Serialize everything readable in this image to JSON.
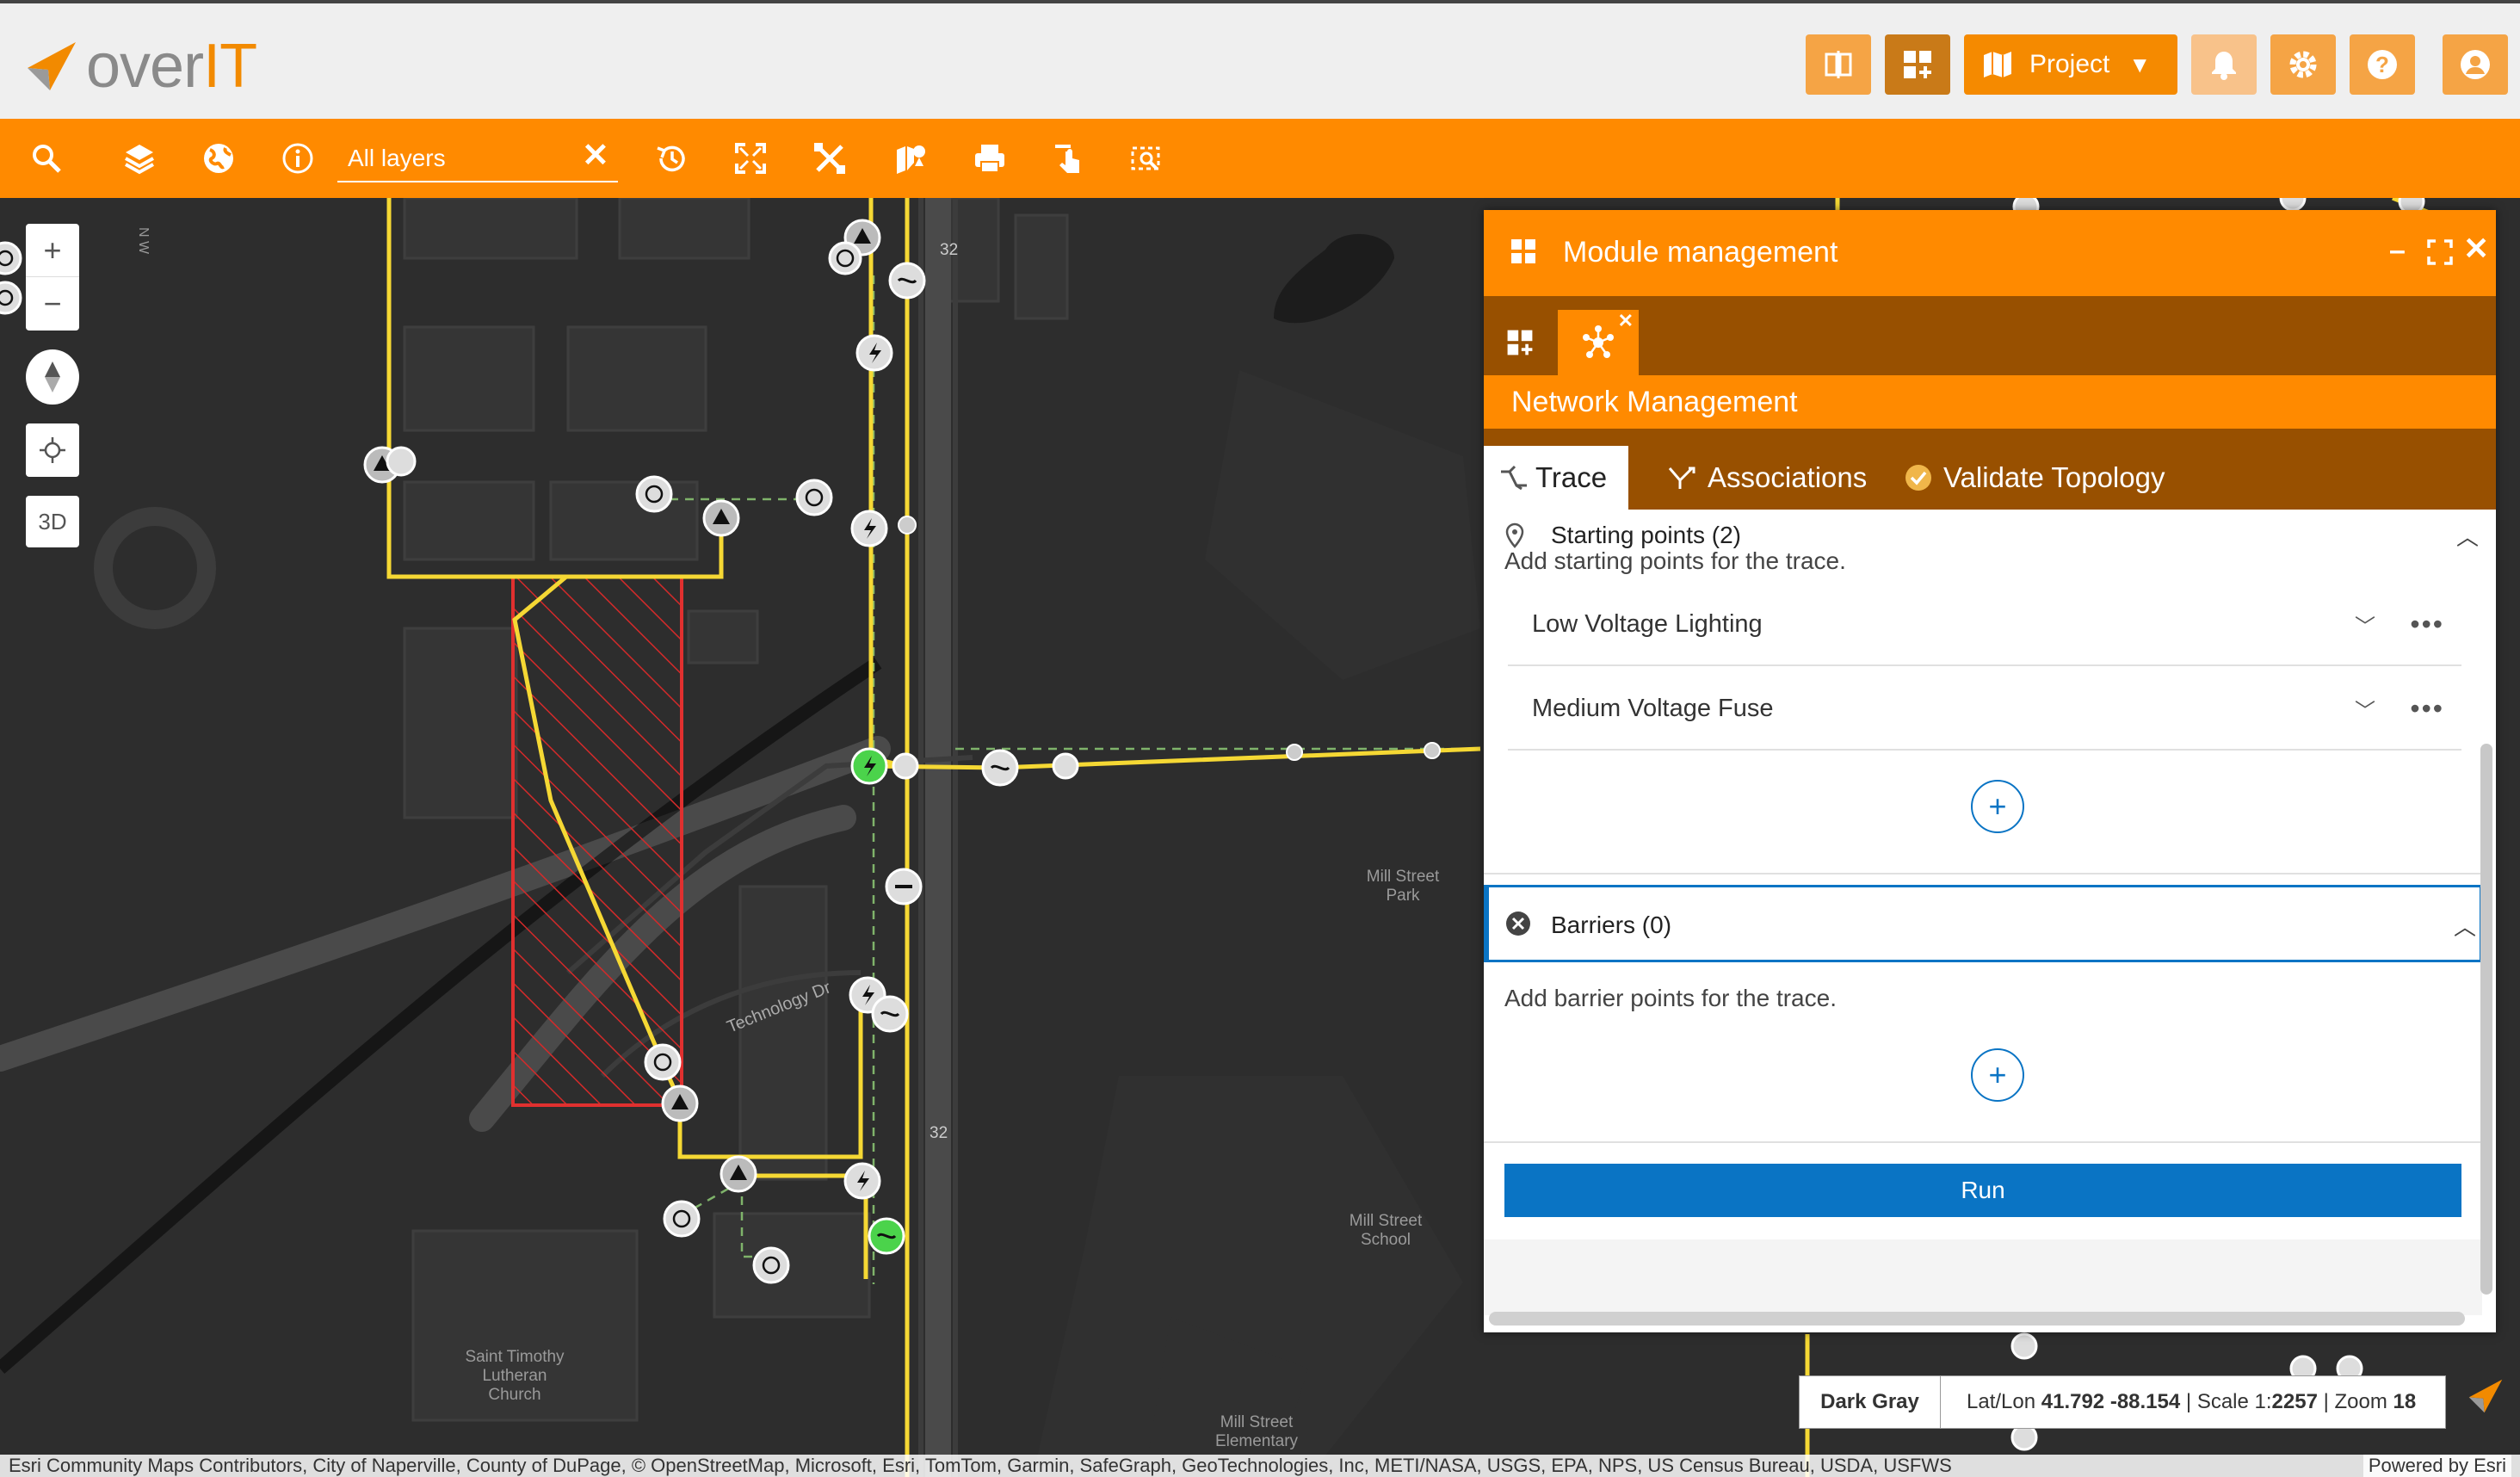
{
  "app": {
    "logo_text_a": "over",
    "logo_text_b": "IT",
    "brand_color": "#ff8a00"
  },
  "header": {
    "buttons": [
      {
        "icon": "split-view-icon"
      },
      {
        "icon": "add-widget-icon"
      },
      {
        "icon": "map-icon",
        "label": "Project"
      },
      {
        "icon": "bell-icon"
      },
      {
        "icon": "gear-icon"
      },
      {
        "icon": "help-icon"
      },
      {
        "icon": "user-icon"
      }
    ],
    "project_label": "Project"
  },
  "toolbar": {
    "layers_value": "All layers",
    "tools": [
      "search-icon",
      "layers-icon",
      "globe-icon",
      "info-icon",
      "history-icon",
      "fullscreen-icon",
      "tools-icon",
      "map-pin-icon",
      "print-icon",
      "touch-icon",
      "select-area-icon"
    ]
  },
  "map": {
    "controls": {
      "zoom_in": "+",
      "zoom_out": "−",
      "three_d": "3D"
    },
    "labels": {
      "street": "Technology Dr",
      "route_a": "32",
      "route_b": "32",
      "park": "Mill Street\nPark",
      "school": "Mill Street\nSchool",
      "church": "Saint Timothy\nLutheran\nChurch",
      "elementary": "Mill Street\nElementary",
      "nw": "N W"
    },
    "status": {
      "basemap": "Dark Gray",
      "latlon_label": "Lat/Lon",
      "latlon_value": "41.792 -88.154",
      "scale_label": "Scale 1:",
      "scale_value": "2257",
      "zoom_label": "Zoom",
      "zoom_value": "18"
    },
    "attribution": "Esri Community Maps Contributors, City of Naperville, County of DuPage, © OpenStreetMap, Microsoft, Esri, TomTom, Garmin, SafeGraph, GeoTechnologies, Inc, METI/NASA, USGS, EPA, NPS, US Census Bureau, USDA, USFWS",
    "powered": "Powered by Esri"
  },
  "panel": {
    "title": "Module management",
    "subtitle": "Network Management",
    "tabs": [
      {
        "label": "Trace",
        "active": true
      },
      {
        "label": "Associations",
        "active": false
      },
      {
        "label": "Validate Topology",
        "active": false
      }
    ],
    "starting_points": {
      "title": "Starting points (2)",
      "hint": "Add starting points for the trace.",
      "items": [
        {
          "label": "Low Voltage Lighting"
        },
        {
          "label": "Medium Voltage Fuse"
        }
      ]
    },
    "barriers": {
      "title": "Barriers (0)",
      "hint": "Add barrier points for the trace."
    },
    "run_label": "Run",
    "accent_blue": "#0a74c4"
  }
}
